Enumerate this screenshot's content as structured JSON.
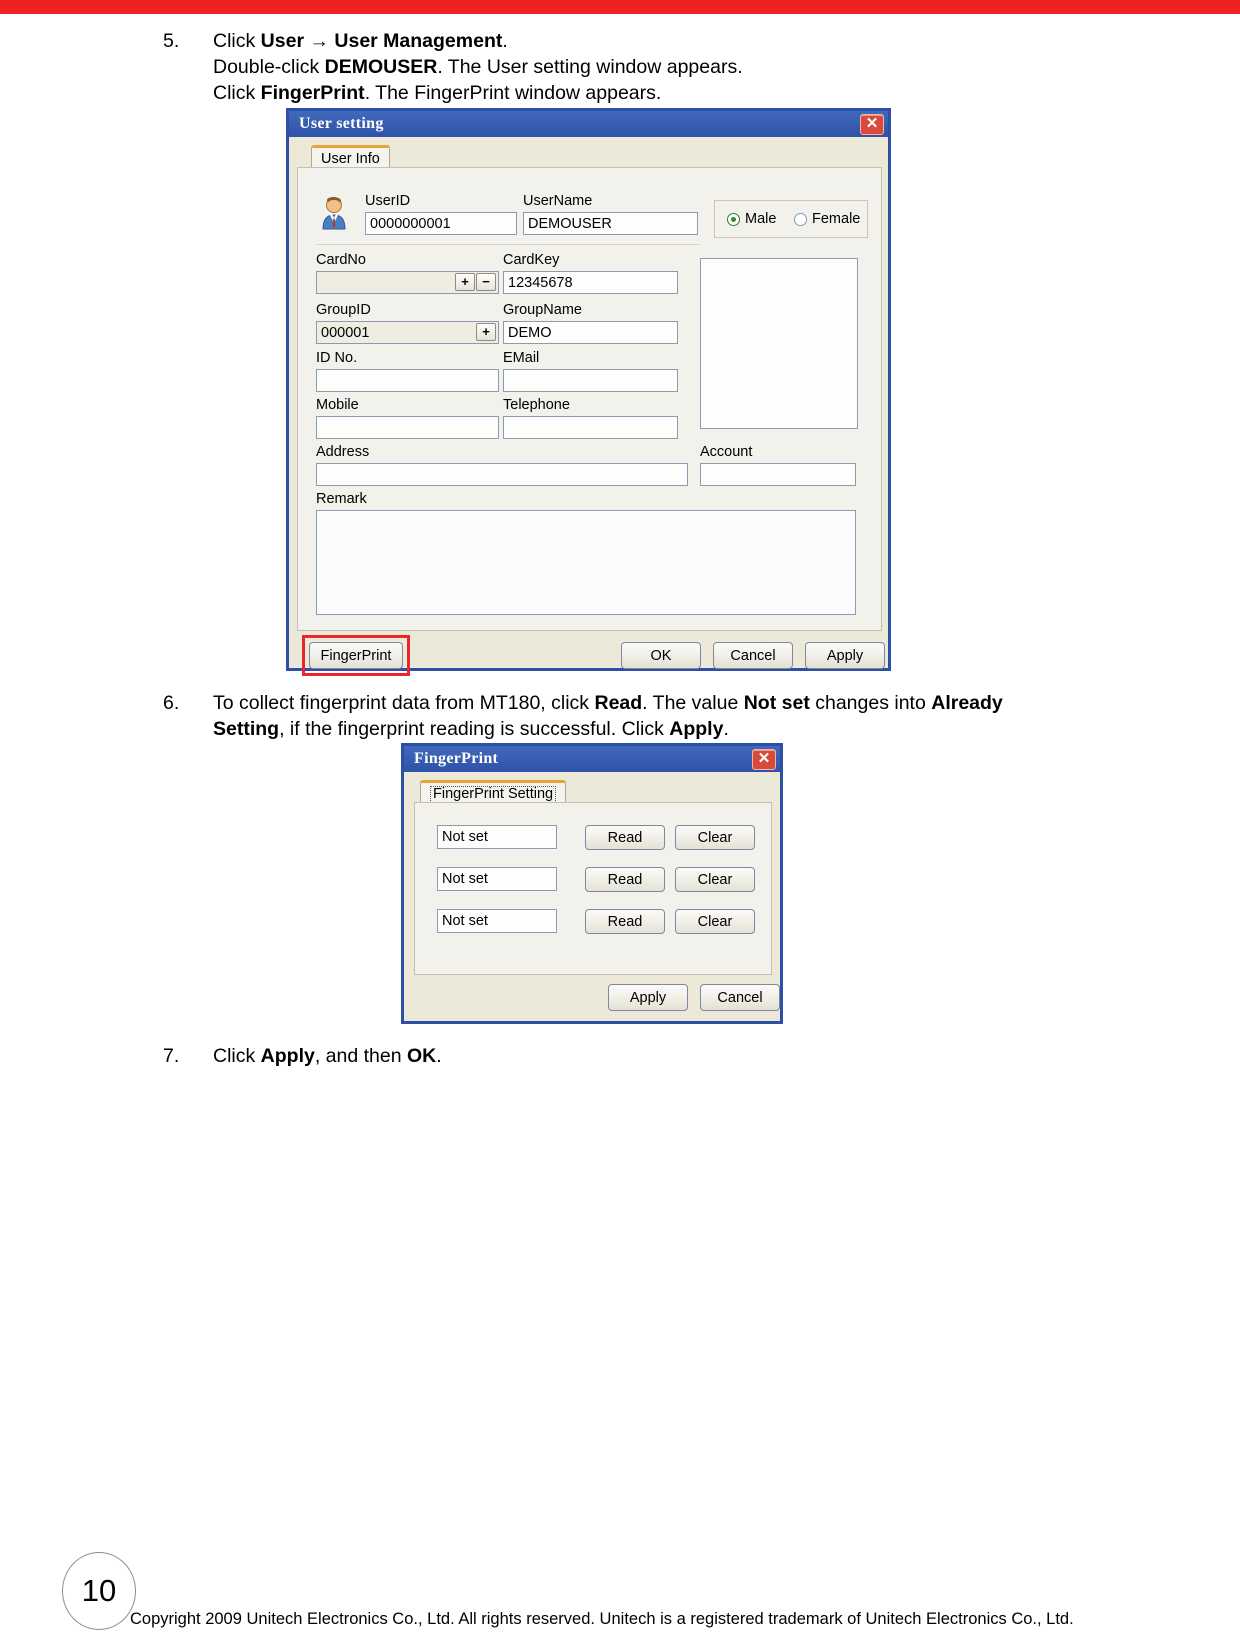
{
  "theme": {
    "top_bar_color": "#ed2224",
    "dialog_titlebar_color": "#2d52a8",
    "highlight_color": "#e8262b",
    "tab_accent_color": "#e8a33d"
  },
  "steps": {
    "step5": {
      "number": "5.",
      "line1_a": "Click ",
      "line1_b": "User",
      "line1_c": " → ",
      "line1_d": "User Management",
      "line1_e": ".",
      "line2_a": "Double-click ",
      "line2_b": "DEMOUSER",
      "line2_c": ". The User setting window appears.",
      "line3_a": "Click ",
      "line3_b": "FingerPrint",
      "line3_c": ". The FingerPrint window appears."
    },
    "step6": {
      "number": "6.",
      "line1_a": "To collect fingerprint data from MT180, click ",
      "line1_b": "Read",
      "line1_c": ". The value ",
      "line1_d": "Not set",
      "line1_e": " changes into ",
      "line1_f": "Already",
      "line2_a": "Setting",
      "line2_b": ", if the fingerprint reading is successful. Click ",
      "line2_c": "Apply",
      "line2_d": "."
    },
    "step7": {
      "number": "7.",
      "line1_a": "Click ",
      "line1_b": "Apply",
      "line1_c": ", and then ",
      "line1_d": "OK",
      "line1_e": "."
    }
  },
  "user_setting_dialog": {
    "title": "User setting",
    "close_label": "✕",
    "tab_label": "User Info",
    "avatar_icon": "user-avatar-icon",
    "fields": {
      "userid_label": "UserID",
      "userid_value": "0000000001",
      "username_label": "UserName",
      "username_value": "DEMOUSER",
      "cardno_label": "CardNo",
      "cardno_value": "",
      "cardno_plus": "+",
      "cardno_minus": "−",
      "cardkey_label": "CardKey",
      "cardkey_value": "12345678",
      "groupid_label": "GroupID",
      "groupid_value": "000001",
      "groupid_plus": "+",
      "groupname_label": "GroupName",
      "groupname_value": "DEMO",
      "idno_label": "ID No.",
      "idno_value": "",
      "email_label": "EMail",
      "email_value": "",
      "mobile_label": "Mobile",
      "mobile_value": "",
      "telephone_label": "Telephone",
      "telephone_value": "",
      "address_label": "Address",
      "address_value": "",
      "account_label": "Account",
      "account_value": "",
      "remark_label": "Remark",
      "remark_value": ""
    },
    "gender": {
      "male_label": "Male",
      "female_label": "Female",
      "selected": "Male"
    },
    "buttons": {
      "fingerprint": "FingerPrint",
      "ok": "OK",
      "cancel": "Cancel",
      "apply": "Apply"
    }
  },
  "fingerprint_dialog": {
    "title": "FingerPrint",
    "close_label": "✕",
    "tab_label": "FingerPrint Setting",
    "rows": [
      {
        "status": "Not set",
        "read": "Read",
        "clear": "Clear"
      },
      {
        "status": "Not set",
        "read": "Read",
        "clear": "Clear"
      },
      {
        "status": "Not set",
        "read": "Read",
        "clear": "Clear"
      }
    ],
    "buttons": {
      "apply": "Apply",
      "cancel": "Cancel"
    }
  },
  "footer": {
    "page_number": "10",
    "copyright": "Copyright 2009 Unitech Electronics Co., Ltd. All rights reserved. Unitech is a registered trademark of Unitech Electronics Co., Ltd."
  }
}
